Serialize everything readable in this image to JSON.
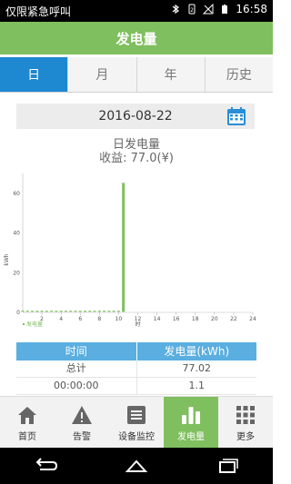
{
  "status_bar": {
    "carrier": "仅限紧急呼叫",
    "time": "16:58",
    "icons": [
      "bluetooth-icon",
      "vibrate-icon",
      "no-signal-icon",
      "battery-icon"
    ]
  },
  "app_bar": {
    "title": "发电量"
  },
  "tabs": [
    {
      "label": "日",
      "active": true
    },
    {
      "label": "月",
      "active": false
    },
    {
      "label": "年",
      "active": false
    },
    {
      "label": "历史",
      "active": false
    }
  ],
  "date_picker": {
    "date": "2016-08-22",
    "icon": "calendar-icon"
  },
  "summary": {
    "title": "日发电量",
    "income": "收益: 77.0(¥)"
  },
  "chart_data": {
    "type": "bar",
    "x": [
      0,
      0.5,
      1,
      1.5,
      2,
      2.5,
      3,
      3.5,
      4,
      4.5,
      5,
      5.5,
      6,
      6.5,
      7,
      7.5,
      8,
      8.5,
      9,
      9.5,
      10,
      10.5
    ],
    "values": [
      0,
      0,
      0,
      0,
      0,
      0,
      0,
      0,
      0,
      0,
      0,
      0,
      0,
      0,
      0,
      0,
      0,
      0,
      0,
      0,
      0,
      65
    ],
    "xticks": [
      "2",
      "4",
      "6",
      "8",
      "10",
      "12",
      "14",
      "16",
      "18",
      "20",
      "22",
      "24"
    ],
    "xtick_values": [
      2,
      4,
      6,
      8,
      10,
      12,
      14,
      16,
      18,
      20,
      22,
      24
    ],
    "xlim": [
      0,
      24
    ],
    "xunit": "时",
    "ylabel": "kWh",
    "yticks": [
      "0",
      "20",
      "40",
      "60"
    ],
    "ylim": [
      0,
      70
    ],
    "legend": "发电量",
    "bar_color": "#7fbf5f"
  },
  "table": {
    "headers": [
      "时间",
      "发电量(kWh)"
    ],
    "rows": [
      [
        "总计",
        "77.02"
      ],
      [
        "00:00:00",
        "1.1"
      ]
    ]
  },
  "bottom_nav": [
    {
      "label": "首页",
      "icon": "home-icon",
      "active": false
    },
    {
      "label": "告警",
      "icon": "warning-icon",
      "active": false
    },
    {
      "label": "设备监控",
      "icon": "device-monitor-icon",
      "active": false
    },
    {
      "label": "发电量",
      "icon": "bar-chart-icon",
      "active": true
    },
    {
      "label": "更多",
      "icon": "more-grid-icon",
      "active": false
    }
  ]
}
